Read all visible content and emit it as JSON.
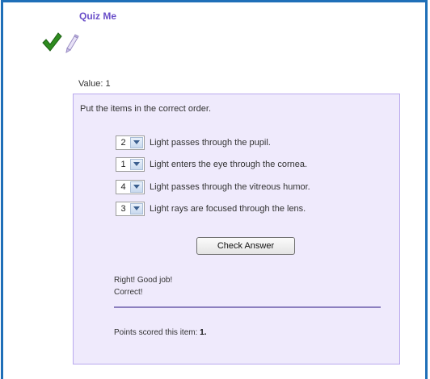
{
  "quiz": {
    "title": "Quiz Me"
  },
  "icons": {
    "result": "checkmark-icon",
    "note": "pencil-icon"
  },
  "value": {
    "label": "Value:",
    "amount": "1"
  },
  "question": {
    "instruction": "Put the items in the correct order.",
    "items": [
      {
        "order": "2",
        "text": "Light passes through the pupil."
      },
      {
        "order": "1",
        "text": "Light enters the eye through the cornea."
      },
      {
        "order": "4",
        "text": "Light passes through the vitreous humor."
      },
      {
        "order": "3",
        "text": "Light rays are focused through the lens."
      }
    ]
  },
  "actions": {
    "check_label": "Check Answer"
  },
  "feedback": {
    "line1": "Right! Good job!",
    "line2": "Correct!"
  },
  "score": {
    "label": "Points scored this item:",
    "value": "1."
  },
  "colors": {
    "frame": "#1f6fb8",
    "title": "#6a4fc9",
    "box_background": "#efeafc",
    "box_border": "#b9a8ee",
    "check": "#2e8b1f"
  }
}
